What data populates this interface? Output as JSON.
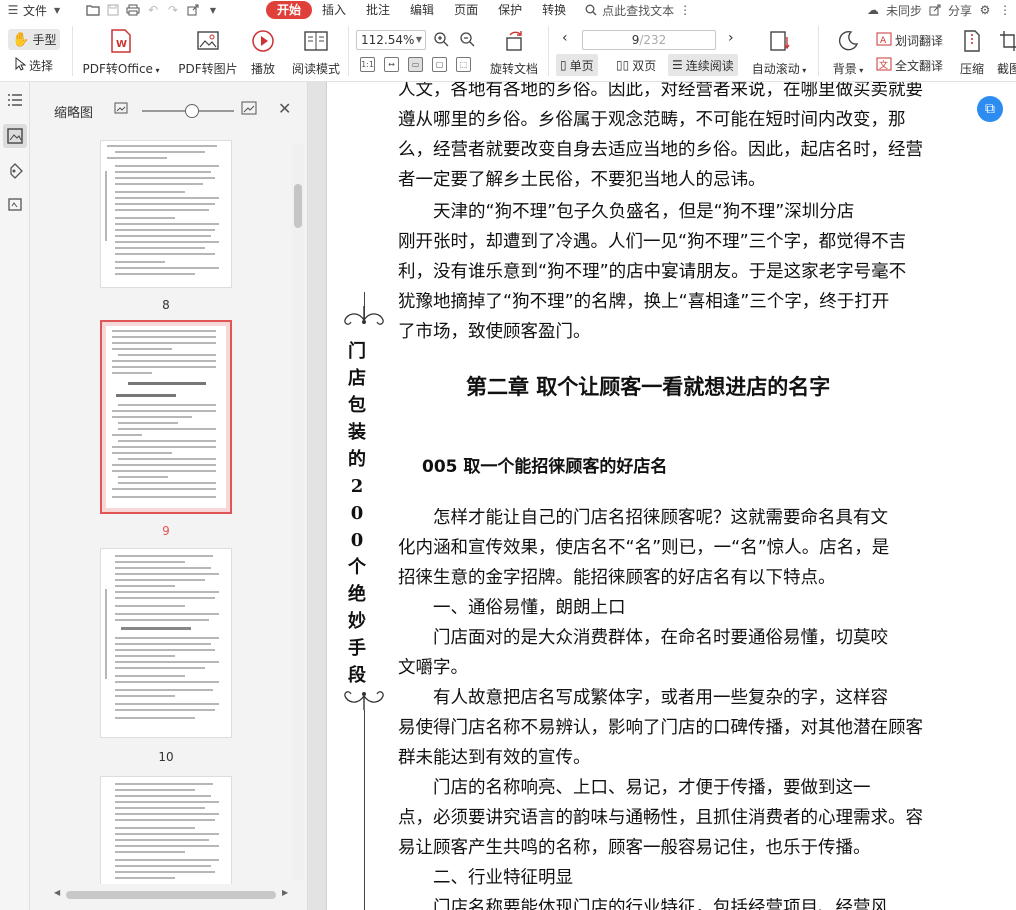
{
  "menubar": {
    "file_label": "文件",
    "tabs": [
      "开始",
      "插入",
      "批注",
      "编辑",
      "页面",
      "保护",
      "转换"
    ],
    "search_label": "点此查找文本",
    "sync_label": "未同步",
    "share_label": "分享"
  },
  "toolbar": {
    "hand_label": "手型",
    "select_label": "选择",
    "pdf_office": "PDF转Office",
    "pdf_image": "PDF转图片",
    "play": "播放",
    "read_mode": "阅读模式",
    "zoom": "112.54%",
    "rotate": "旋转文档",
    "page_current": "9",
    "page_total": "/232",
    "single_page": "单页",
    "double_page": "双页",
    "continuous": "连续阅读",
    "auto_scroll": "自动滚动",
    "background": "背景",
    "word_translate": "划词翻译",
    "full_translate": "全文翻译",
    "compress": "压缩",
    "crop": "截图"
  },
  "thumbnail_panel": {
    "title": "缩略图",
    "pages": [
      "8",
      "9",
      "10"
    ],
    "selected_page": "9"
  },
  "document": {
    "vertical_title": [
      "门",
      "店",
      "包",
      "装",
      "的",
      "2",
      "0",
      "0",
      "个",
      "绝",
      "妙",
      "手",
      "段"
    ],
    "lines_top": [
      "人文，各地有各地的乡俗。因此，对经营者来说，在哪里做买卖就要",
      "遵从哪里的乡俗。乡俗属于观念范畴，不可能在短时间内改变，那",
      "么，经营者就要改变自身去适应当地的乡俗。因此，起店名时，经营",
      "者一定要了解乡土民俗，不要犯当地人的忌讳。",
      "　　天津的“狗不理”包子久负盛名，但是“狗不理”深圳分店",
      "刚开张时，却遭到了冷遇。人们一见“狗不理”三个字，都觉得不吉",
      "利，没有谁乐意到“狗不理”的店中宴请朋友。于是这家老字号毫不",
      "犹豫地摘掉了“狗不理”的名牌，换上“喜相逢”三个字，终于打开",
      "了市场，致使顾客盈门。"
    ],
    "chapter_heading": "第二章  取个让顾客一看就想进店的名字",
    "section_heading": "005 取一个能招徕顾客的好店名",
    "lines_bottom": [
      "　　怎样才能让自己的门店名招徕顾客呢？这就需要命名具有文",
      "化内涵和宣传效果，使店名不“名”则已，一“名”惊人。店名，是",
      "招徕生意的金字招牌。能招徕顾客的好店名有以下特点。",
      "　　一、通俗易懂，朗朗上口",
      "　　门店面对的是大众消费群体，在命名时要通俗易懂，切莫咬",
      "文嚼字。",
      "　　有人故意把店名写成繁体字，或者用一些复杂的字，这样容",
      "易使得门店名称不易辨认，影响了门店的口碑传播，对其他潜在顾客",
      "群未能达到有效的宣传。",
      "　　门店的名称响亮、上口、易记，才便于传播，要做到这一",
      "点，必须要讲究语言的韵味与通畅性，且抓住消费者的心理需求。容",
      "易让顾客产生共鸣的名称，顾客一般容易记住，也乐于传播。",
      "　　二、行业特征明显",
      "　　门店名称要能体现门店的行业特征，包括经营项目、经营风"
    ]
  }
}
